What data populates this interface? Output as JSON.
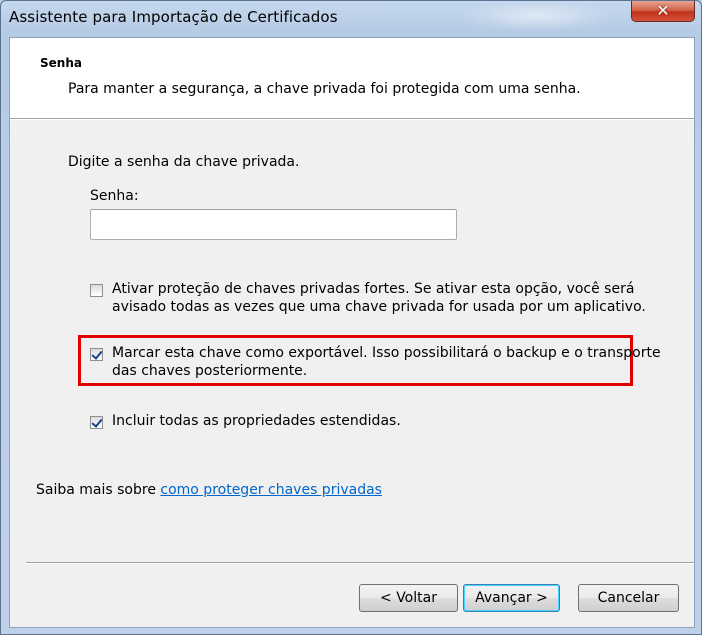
{
  "window": {
    "title": "Assistente para Importação de Certificados",
    "close_symbol": "✕",
    "close_icon": "close-icon"
  },
  "header": {
    "title": "Senha",
    "description": "Para manter a segurança, a chave privada foi protegida com uma senha."
  },
  "body": {
    "prompt": "Digite a senha da chave privada.",
    "password_label": "Senha:",
    "password_value": "",
    "options": [
      {
        "label_line1": "Ativar proteção de chaves privadas fortes. Se ativar esta opção, você será",
        "label_line2": "avisado todas as vezes que uma chave privada for usada por um aplicativo.",
        "checked": false
      },
      {
        "label_line1": "Marcar esta chave como exportável. Isso possibilitará o backup e o transporte",
        "label_line2": "das chaves posteriormente.",
        "checked": true,
        "highlighted": true
      },
      {
        "label_line1": "Incluir todas as propriedades estendidas.",
        "checked": true
      }
    ],
    "learn_more_prefix": "Saiba mais sobre",
    "learn_more_link": "como proteger chaves privadas"
  },
  "buttons": {
    "back": "< Voltar",
    "next": "Avançar >",
    "cancel": "Cancelar"
  },
  "colors": {
    "highlight_border": "#e00000",
    "link": "#0066cc",
    "close_button": "#c7402a"
  }
}
